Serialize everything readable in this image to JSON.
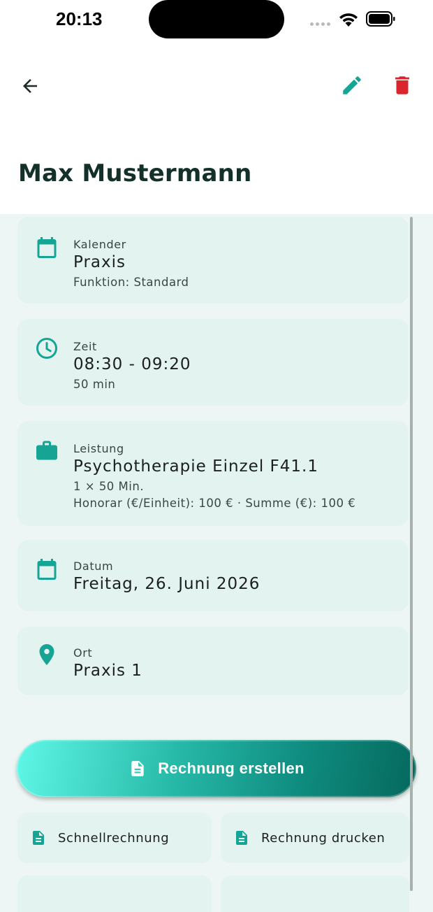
{
  "status_bar": {
    "time": "20:13"
  },
  "app_bar": {
    "back_icon": "arrow-back-icon",
    "edit_icon": "pencil-icon",
    "delete_icon": "trash-icon"
  },
  "page": {
    "title": "Max Mustermann"
  },
  "colors": {
    "accent": "#16a595",
    "delete": "#d9262c",
    "title": "#14302b",
    "card_bg": "#e3f3f0",
    "panel_bg": "#edf6f4"
  },
  "details": [
    {
      "icon": "calendar-icon",
      "label": "Kalender",
      "value": "Praxis",
      "sub": [
        "Funktion: Standard"
      ]
    },
    {
      "icon": "clock-icon",
      "label": "Zeit",
      "value": "08:30 - 09:20",
      "sub": [
        "50 min"
      ]
    },
    {
      "icon": "briefcase-icon",
      "label": "Leistung",
      "value": "Psychotherapie Einzel F41.1",
      "sub": [
        "1 × 50 Min.",
        "Honorar (€/Einheit): 100 € · Summe (€): 100 €"
      ]
    },
    {
      "icon": "calendar-icon",
      "label": "Datum",
      "value": "Freitag, 26. Juni  2026",
      "sub": []
    },
    {
      "icon": "location-pin-icon",
      "label": "Ort",
      "value": "Praxis 1",
      "sub": []
    }
  ],
  "actions": {
    "primary": {
      "icon": "document-icon",
      "label": "Rechnung erstellen"
    },
    "quick_invoice": {
      "icon": "document-icon",
      "label": "Schnellrechnung"
    },
    "print_invoice": {
      "icon": "document-icon",
      "label": "Rechnung drucken"
    }
  }
}
